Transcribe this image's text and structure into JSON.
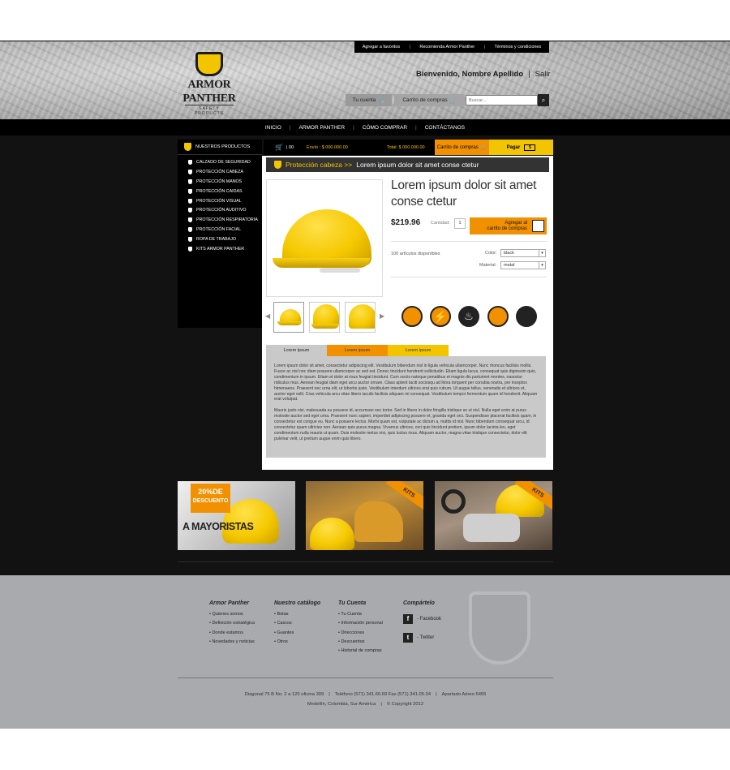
{
  "top_links": [
    "Agregar a favoritos",
    "Recomienda Armor Panther",
    "Términos y condiciones"
  ],
  "logo": {
    "name_line1": "ARMOR",
    "name_line2": "PANTHER",
    "tagline": "SAFETY PRODUCTS"
  },
  "header": {
    "welcome": "Bienvenido, Nombre Apellido",
    "logout": "Salir",
    "account_label": "Tu cuenta",
    "cart_label": "Carrito de compras",
    "search_placeholder": "Buscar..."
  },
  "nav": [
    "INICIO",
    "ARMOR PANTHER",
    "CÓMO COMPRAR",
    "CONTÁCTANOS"
  ],
  "sidebar": {
    "title": "NUESTROS PRODUCTOS",
    "items": [
      "CALZADO DE SEGURIDAD",
      "PROTECCIÓN CABEZA",
      "PROTECCIÓN MANOS",
      "PROTECCIÓN CAIDAS",
      "PROTECCIÓN VISUAL",
      "PROTECCIÓN AUDITIVO",
      "PROTECCIÓN RESPIRATORIA",
      "PROTECCIÓN FACIAL",
      "ROPA DE TRABAJO",
      "KITS ARMOR PANTHER"
    ]
  },
  "cartbar": {
    "qty": "| 00",
    "shipping": "Envío : $ 000.000.00",
    "total": "Total: $ 000.000.00",
    "cart_label": "Carrito de compras",
    "pay_label": "Pagar"
  },
  "breadcrumb": {
    "category": "Protección cabeza >>",
    "current": "Lorem ipsum dolor sit amet conse ctetur"
  },
  "product": {
    "title": "Lorem ipsum dolor sit amet conse ctetur",
    "price": "$219.96",
    "qty_label": "Cantidad:",
    "qty_value": "1",
    "add_to_cart_line1": "Agregar al",
    "add_to_cart_line2": "carrito de compras",
    "availability": "100 artículos disponibles",
    "color_label": "Color:",
    "color_value": "black",
    "material_label": "Material:",
    "material_value": "metal"
  },
  "property_icons": [
    "boot-icon",
    "electric-icon",
    "fire-icon",
    "head-icon",
    "weather-icon"
  ],
  "tabs": [
    "Lorem ipsum",
    "Lorem ipsum",
    "Lorem ipsum"
  ],
  "description": [
    "Lorem ipsum dolor sit amet, consectetur adipiscing elit. Vestibulum bibendum nisl in ligula vehicula ullamcorper. Nunc rhoncus facilisis mollis. Fusce ac nisl nec diam posuere ullamcorper ac sed est. Donec tincidunt hendrerit sollicitudin. Etiam ligula lacus, consequat quis dignissim quis, condimentum in ipsum. Etiam et dolor at risus feugiat tincidunt. Cum sociis natoque penatibus et magnis dis parturient montes, nascetur ridiculus mus. Aenean feugiat diam eget arcu auctor ornare. Class aptent taciti sociosqu ad litora torquent per conubia nostra, per inceptos himenaeos. Praesent nec urna elit, ut lobortis justo. Vestibulum interdum ultrices erat quis rutrum. Ut augue tellus, venenatis et ultrices et, auctor eget velit. Cras vehicula arcu vitae libero iaculis facilisis aliquam mi consequat. Vestibulum tempor fermentum quam id hendrerit. Aliquam erat volutpat.",
    "Mauris justo nisi, malesuada eu posuere id, accumsan nec tortor. Sed in libero in dolor fringilla tristique ac ut nisl. Nulla eget enim at purus molestie auctor sed eget urna. Praesent nunc sapien, imperdiet adipiscing posuere et, gravida eget orci. Suspendisse placerat facilisis quam, in consectetur est congue eu. Nunc a posuere lectus. Morbi quam est, vulputate ac dictum a, mattis id nisl. Nunc bibendum consequat arcu, id consectetur quam ultricies non. Aenean quis purus magna. Vivamus ultrices, orci quis tincidunt pretium, ipsum dolor lacinia leo, eget condimentum nulla mauris ut quam. Duis molestie metus nisi, quis luctus risus. Aliquam auctor, magna vitae tristique consectetur, dolor elit pulvinar velit, ut pretium augue enim quis libero."
  ],
  "banners": {
    "promo_line1": "20%DE",
    "promo_line2": "DESCUENTO",
    "promo_line3": "A MAYORISTAS",
    "kits_label": "KITS"
  },
  "footer": {
    "col1": {
      "title": "Armor Panther",
      "items": [
        "• Quienes somos",
        "• Definición estratégica",
        "• Donde estamos",
        "• Novedades y noticias"
      ]
    },
    "col2": {
      "title": "Nuestro catálogo",
      "items": [
        "• Botas",
        "• Cascos",
        "• Guantes",
        "• Otros"
      ]
    },
    "col3": {
      "title": "Tu Cuenta",
      "items": [
        "• Tu Cuenta",
        "• Información personal",
        "• Direcciones",
        "• Descuentos",
        "• Historial de compras"
      ]
    },
    "col4": {
      "title": "Compártelo",
      "facebook": "- Facebook",
      "twitter": "- Twitter"
    },
    "address_line1": "Diagonal 75 B No. 2 a 120 oficina 309",
    "phone": "Teléfono (571) 341.60.60 Fax (571) 341.05.04",
    "po_box": "Apartado Aéreo 5455",
    "city": "Medellín, Colombia, Sur América",
    "copyright": "© Copyright 2012"
  },
  "colors": {
    "accent_yellow": "#f3c400",
    "accent_orange": "#f29100",
    "dark": "#121212",
    "footer": "#a9aaae"
  }
}
